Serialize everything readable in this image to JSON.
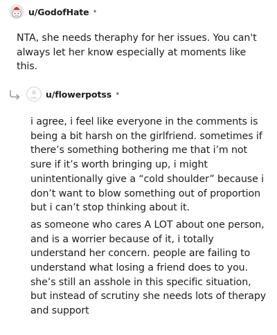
{
  "comments": [
    {
      "username": "u/GodofHate",
      "separator": "•",
      "avatar": "snoo-avatar-red-hat-icon",
      "body": "NTA, she needs theraphy for her issues. You can't always let her know especially at moments like this."
    },
    {
      "username": "u/flowerpotss",
      "separator": "•",
      "avatar": "default-avatar-icon",
      "reply_icon": "reply-arrow-icon",
      "paragraphs": [
        "i agree, i feel like everyone in the comments is being a bit harsh on the girlfriend. sometimes if there’s something bothering me that i’m not sure if it’s worth bringing up, i might unintentionally give a “cold shoulder” because i don’t want to blow something out of proportion but i can’t stop thinking about it.",
        "as someone who cares A LOT about one person, and is a worrier because of it, i totally understand her concern. people are failing to understand what losing a friend does to you. she’s still an asshole in this specific situation, but instead of scrutiny she needs lots of therapy and support"
      ]
    }
  ],
  "colors": {
    "text": "#1c1c1c",
    "meta": "#7c7c7c",
    "reply_icon": "#9a9a9a"
  }
}
